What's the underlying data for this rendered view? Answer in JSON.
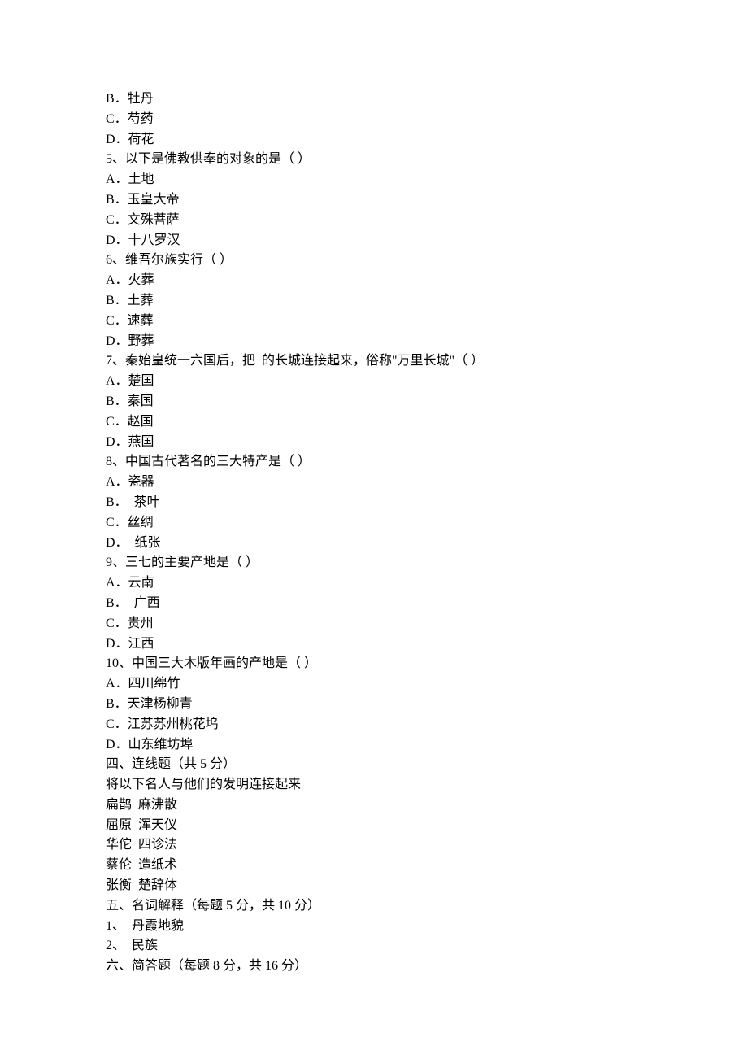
{
  "q4_options": {
    "b": "B．牡丹",
    "c": "C．芍药",
    "d": "D．荷花"
  },
  "q5": {
    "stem": "5、以下是佛教供奉的对象的是（ ）",
    "a": "A．土地",
    "b": "B．玉皇大帝",
    "c": "C．文殊菩萨",
    "d": "D．十八罗汉"
  },
  "q6": {
    "stem": "6、维吾尔族实行（ ）",
    "a": "A．火葬",
    "b": "B．土葬",
    "c": "C．速葬",
    "d": "D．野葬"
  },
  "q7": {
    "stem": "7、秦始皇统一六国后，把  的长城连接起来，俗称\"万里长城\"（ ）",
    "a": "A．楚国",
    "b": "B．秦国",
    "c": "C．赵国",
    "d": "D．燕国"
  },
  "q8": {
    "stem": "8、中国古代著名的三大特产是（ ）",
    "a": "A．瓷器",
    "b": "B．  茶叶",
    "c": "C．丝绸",
    "d": "D．  纸张"
  },
  "q9": {
    "stem": "9、三七的主要产地是（ ）",
    "a": "A．云南",
    "b": "B．  广西",
    "c": "C．贵州",
    "d": "D．江西"
  },
  "q10": {
    "stem": "10、中国三大木版年画的产地是（ ）",
    "a": "A．四川绵竹",
    "b": "B．天津杨柳青",
    "c": "C．江苏苏州桃花坞",
    "d": "D．山东维坊埠"
  },
  "section4": {
    "title": "四、连线题（共 5 分）",
    "instruction": "将以下名人与他们的发明连接起来",
    "pairs": [
      "扁鹊  麻沸散",
      "屈原  浑天仪",
      "华佗  四诊法",
      "蔡伦  造纸术",
      "张衡  楚辞体"
    ]
  },
  "section5": {
    "title": "五、名词解释（每题 5 分，共 10 分）",
    "items": [
      "1、  丹霞地貌",
      "2、  民族"
    ]
  },
  "section6": {
    "title": "六、简答题（每题 8 分，共 16 分）"
  }
}
